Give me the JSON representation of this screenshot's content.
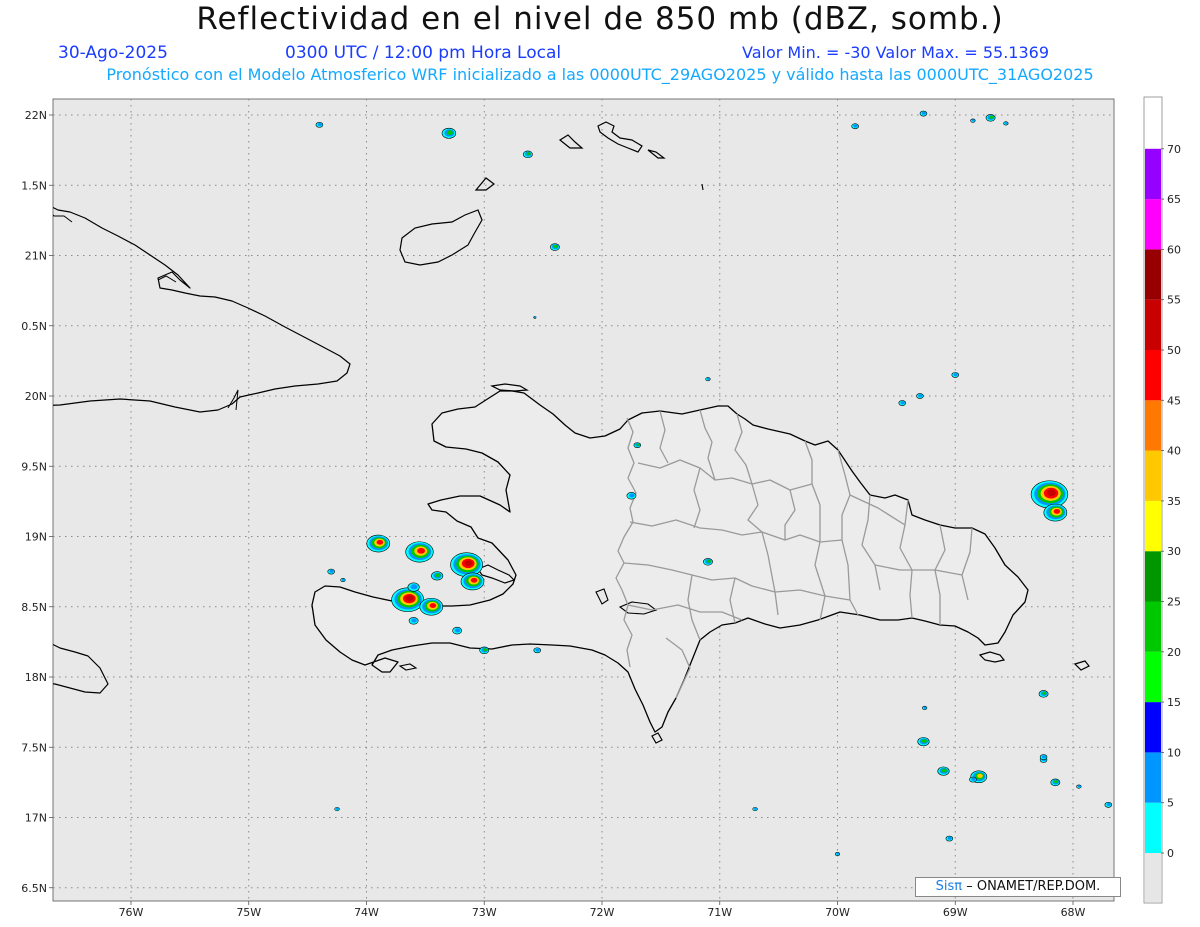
{
  "header": {
    "title": "Reflectividad en el nivel de 850 mb (dBZ, somb.)",
    "date": "30-Ago-2025",
    "time": "0300 UTC / 12:00 pm Hora Local",
    "min_max": "Valor Min. = -30  Valor Max. = 55.1369",
    "subtitle": "Pronóstico con el Modelo Atmosferico WRF inicializado a las 0000UTC_29AGO2025 y válido hasta las  0000UTC_31AGO2025"
  },
  "map": {
    "lon_labels": [
      "76W",
      "75W",
      "74W",
      "73W",
      "72W",
      "71W",
      "70W",
      "69W",
      "68W"
    ],
    "lat_labels": [
      "22N",
      "1.5N",
      "21N",
      "0.5N",
      "20N",
      "9.5N",
      "19N",
      "8.5N",
      "18N",
      "7.5N",
      "17N",
      "6.5N"
    ],
    "background_color": "#e8e8e8",
    "coastline_color": "#000000",
    "province_border_color": "#9a9a9a"
  },
  "colorbar": {
    "labels": [
      "0",
      "5",
      "10",
      "15",
      "20",
      "25",
      "30",
      "35",
      "40",
      "45",
      "50",
      "55",
      "60",
      "65",
      "70"
    ],
    "colors": [
      "#00ffff",
      "#0096ff",
      "#0000ff",
      "#00ff00",
      "#00c800",
      "#009600",
      "#ffff00",
      "#ffc800",
      "#ff7800",
      "#ff0000",
      "#c80000",
      "#960000",
      "#ff00ff",
      "#9600ff"
    ]
  },
  "credit": {
    "logo": "Sisπ",
    "text": "– ONAMET/REP.DOM."
  }
}
